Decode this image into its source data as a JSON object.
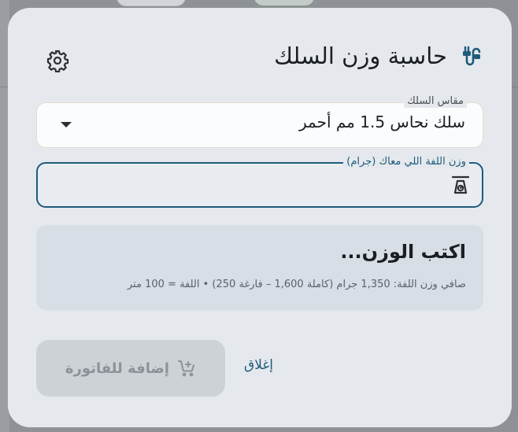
{
  "dialog": {
    "title": "حاسبة وزن السلك",
    "settings_icon": "gear-icon",
    "title_icon": "cable-icon"
  },
  "wire_gauge": {
    "label": "مقاس السلك",
    "selected": "سلك نحاس 1.5 مم أحمر"
  },
  "coil_weight": {
    "label": "وزن اللفة اللي معاك (جرام)",
    "value": "",
    "icon": "scale-icon"
  },
  "result": {
    "title": "اكتب الوزن...",
    "subtitle": "صافي وزن اللفة: 1,350 جرام (كاملة 1,600 – فارغة 250) • اللفة = 100 متر"
  },
  "actions": {
    "add_to_invoice": "إضافة للفاتورة",
    "close": "إغلاق"
  },
  "colors": {
    "accent": "#1f5a7a",
    "dialog_bg": "#e5e9ed",
    "card_bg": "#d7dee5",
    "disabled_bg": "#cdd2d7"
  }
}
